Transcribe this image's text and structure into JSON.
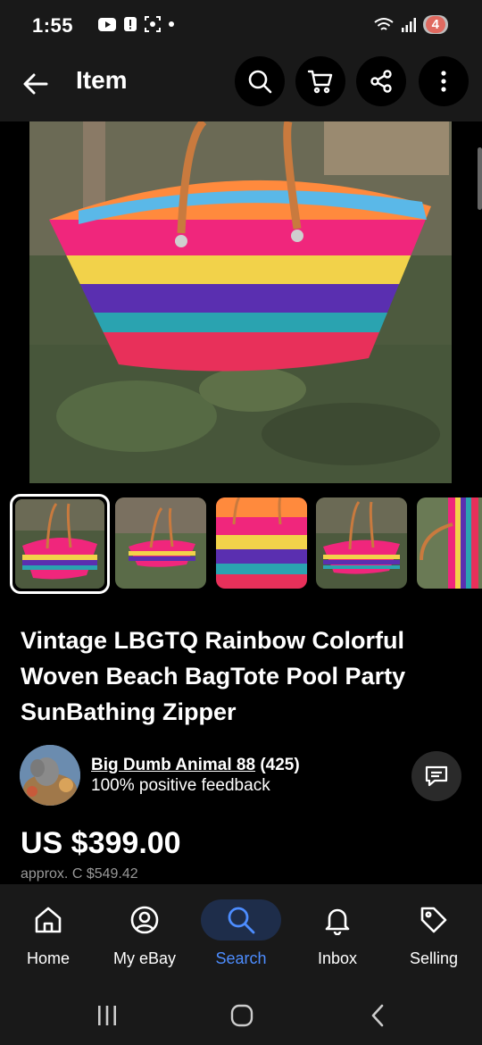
{
  "status": {
    "time": "1:55",
    "battery": "4"
  },
  "appbar": {
    "title": "Item"
  },
  "item": {
    "title": "Vintage LBGTQ Rainbow Colorful Woven Beach BagTote Pool Party SunBathing Zipper",
    "price": "US $399.00",
    "approx_price": "approx. C $549.42"
  },
  "seller": {
    "name": "Big Dumb Animal 88",
    "rating_count": "(425)",
    "feedback": "100% positive feedback"
  },
  "nav": {
    "items": [
      {
        "label": "Home",
        "icon": "home-icon"
      },
      {
        "label": "My eBay",
        "icon": "user-icon"
      },
      {
        "label": "Search",
        "icon": "search-icon"
      },
      {
        "label": "Inbox",
        "icon": "bell-icon"
      },
      {
        "label": "Selling",
        "icon": "tag-icon"
      }
    ],
    "active": "Search"
  },
  "colors": {
    "accent": "#4d8dff",
    "bar_bg": "#191919"
  },
  "gallery": {
    "selected_index": 0,
    "thumbnail_count": 5
  }
}
